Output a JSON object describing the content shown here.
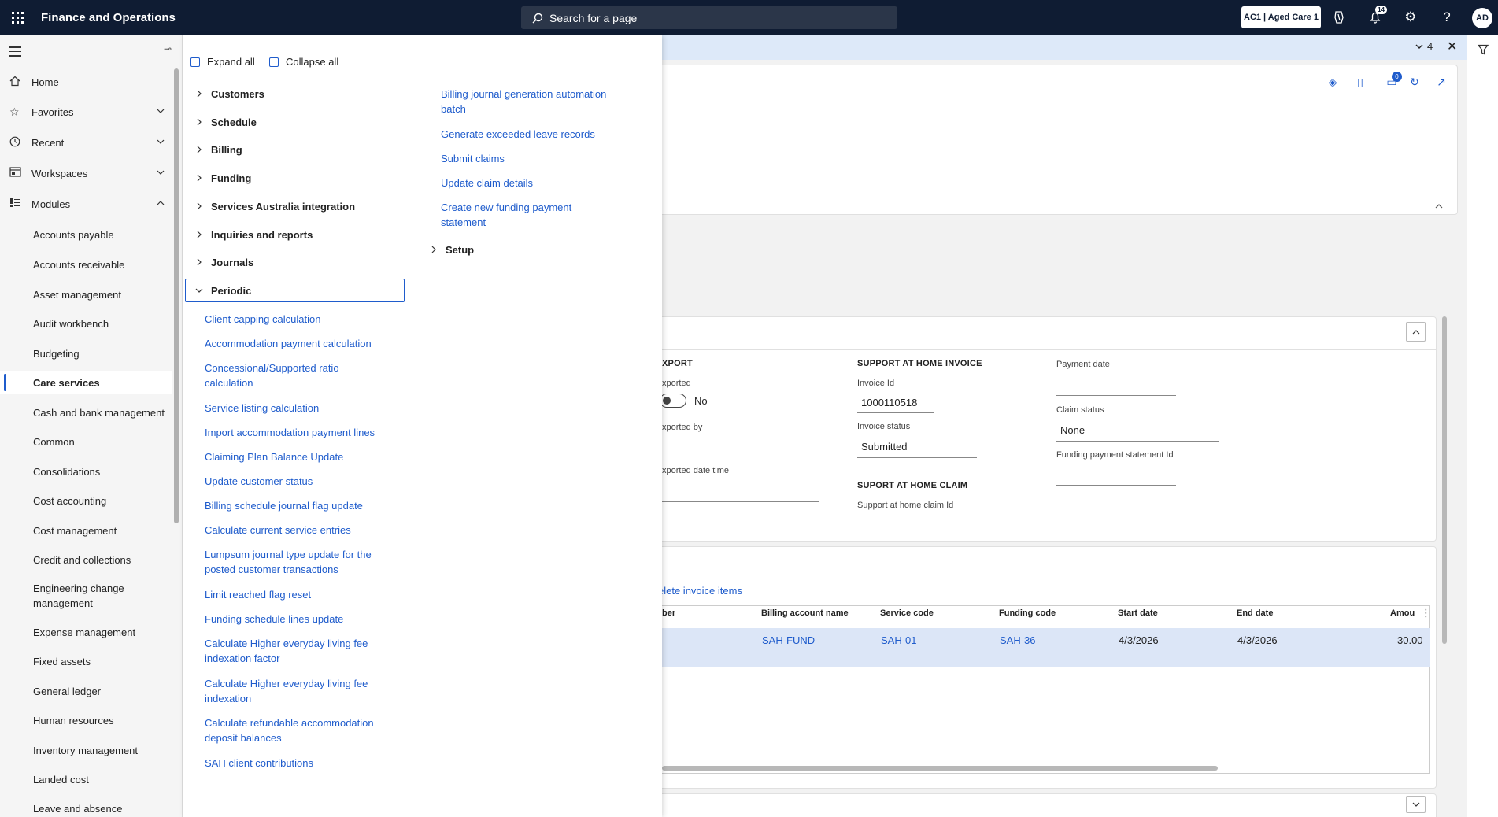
{
  "topbar": {
    "app_title": "Finance and Operations",
    "search_placeholder": "Search for a page",
    "company": "AC1 | Aged Care 1",
    "notification_count": "14",
    "avatar_initials": "AD"
  },
  "nav": {
    "home": "Home",
    "favorites": "Favorites",
    "recent": "Recent",
    "workspaces": "Workspaces",
    "modules": "Modules",
    "module_items": [
      "Accounts payable",
      "Accounts receivable",
      "Asset management",
      "Audit workbench",
      "Budgeting",
      "Care services",
      "Cash and bank management",
      "Common",
      "Consolidations",
      "Cost accounting",
      "Cost management",
      "Credit and collections",
      "Engineering change management",
      "Expense management",
      "Fixed assets",
      "General ledger",
      "Human resources",
      "Inventory management",
      "Landed cost",
      "Leave and absence"
    ]
  },
  "menu": {
    "expand_all": "Expand all",
    "collapse_all": "Collapse all",
    "groups": [
      "Customers",
      "Schedule",
      "Billing",
      "Funding",
      "Services Australia integration",
      "Inquiries and reports",
      "Journals",
      "Periodic"
    ],
    "periodic_links": [
      "Client capping calculation",
      "Accommodation payment calculation",
      "Concessional/Supported ratio calculation",
      "Service listing calculation",
      "Import accommodation payment lines",
      "Claiming Plan Balance Update",
      "Update customer status",
      "Billing schedule journal flag update",
      "Calculate current service entries",
      "Lumpsum journal type update for the posted customer transactions",
      "Limit reached flag reset",
      "Funding schedule lines update",
      "Calculate Higher everyday living fee indexation factor",
      "Calculate Higher everyday living fee indexation",
      "Calculate refundable accommodation deposit balances",
      "SAH client contributions"
    ],
    "right_links": [
      "Billing journal generation automation batch",
      "Generate exceeded leave records",
      "Submit claims",
      "Update claim details",
      "Create new funding payment statement"
    ],
    "setup": "Setup"
  },
  "form": {
    "strip_count": "4",
    "export_title": "XPORT",
    "exported_label": "xported",
    "exported_value": "No",
    "exported_by_label": "xported by",
    "exported_dt_label": "xported date time",
    "invoice_section": "SUPPORT AT HOME INVOICE",
    "invoice_id_label": "Invoice Id",
    "invoice_id_value": "1000110518",
    "invoice_status_label": "Invoice status",
    "invoice_status_value": "Submitted",
    "claim_section": "SUPORT AT HOME CLAIM",
    "claim_id_label": "Support at home claim Id",
    "payment_date_label": "Payment date",
    "claim_status_label": "Claim status",
    "claim_status_value": "None",
    "funding_stmt_label": "Funding payment statement Id",
    "delete_items": "elete invoice items",
    "grid_headers": [
      "ber",
      "Billing account name",
      "Service code",
      "Funding code",
      "Start date",
      "End date",
      "Amou"
    ],
    "grid_row": [
      "SAH-FUND",
      "SAH-01",
      "SAH-36",
      "4/3/2026",
      "4/3/2026",
      "30.00"
    ]
  }
}
